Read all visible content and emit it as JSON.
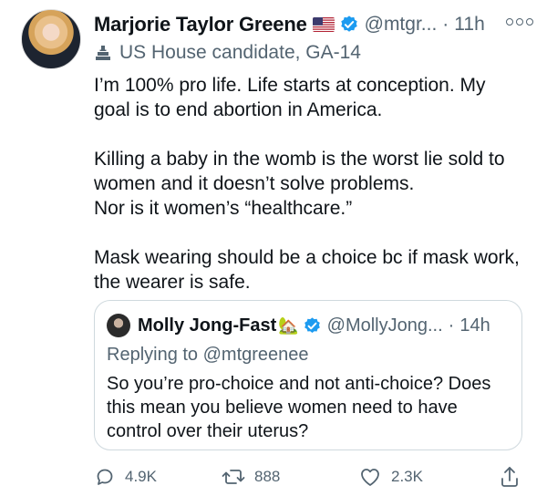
{
  "tweet": {
    "author_name": "Marjorie Taylor Greene",
    "handle": "@mtgr...",
    "separator": "·",
    "time": "11h",
    "label": "US House candidate, GA-14",
    "paragraphs": [
      "I’m 100% pro life.  Life starts at conception.  My goal is to end abortion in America.",
      "Killing a baby in the womb is the worst lie sold to women and it doesn’t solve problems.\nNor is it women’s “healthcare.”",
      "Mask wearing should be a choice bc if mask work, the wearer is safe."
    ]
  },
  "quoted": {
    "author_name": "Molly Jong-Fast",
    "house_emoji": "🏡",
    "handle": "@MollyJong...",
    "separator": "·",
    "time": "14h",
    "replying_prefix": "Replying to",
    "replying_to": "@mtgreenee",
    "text": "So you’re pro-choice and not anti-choice? Does this mean you believe women need to have control over their uterus?"
  },
  "actions": {
    "replies": "4.9K",
    "retweets": "888",
    "likes": "2.3K"
  },
  "colors": {
    "text": "#0f1419",
    "secondary": "#536471",
    "verified": "#1d9bf0",
    "border": "#cfd9de"
  },
  "icons": [
    "flag-us-icon",
    "verified-icon",
    "more-icon",
    "government-label-icon",
    "reply-icon",
    "retweet-icon",
    "like-icon",
    "share-icon"
  ]
}
